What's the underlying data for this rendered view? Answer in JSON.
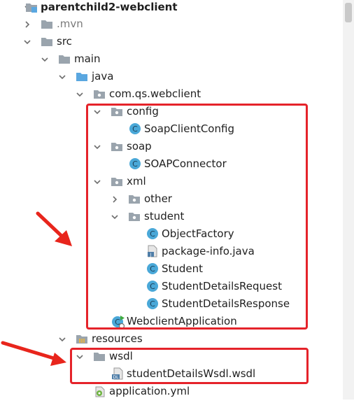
{
  "tree": {
    "project": "parentchild2-webclient",
    "mvn": ".mvn",
    "src": "src",
    "main": "main",
    "java": "java",
    "package": "com.qs.webclient",
    "config": "config",
    "soap_client_config": "SoapClientConfig",
    "soap": "soap",
    "soap_connector": "SOAPConnector",
    "xml": "xml",
    "other": "other",
    "student_pkg": "student",
    "object_factory": "ObjectFactory",
    "package_info": "package-info.java",
    "student_class": "Student",
    "student_details_request": "StudentDetailsRequest",
    "student_details_response": "StudentDetailsResponse",
    "webclient_application": "WebclientApplication",
    "resources": "resources",
    "wsdl": "wsdl",
    "wsdl_file": "studentDetailsWsdl.wsdl",
    "application_yml": "application.yml"
  },
  "icon_badges": {
    "class": "C",
    "java": "J",
    "wsdl": "DL"
  },
  "colors": {
    "highlight_border": "#e5232a",
    "arrow": "#e8251c",
    "class_icon": "#4aa8d8",
    "folder": "#9aa4ad",
    "source_folder": "#5aa7e0",
    "run_badge": "#3faa3f"
  }
}
